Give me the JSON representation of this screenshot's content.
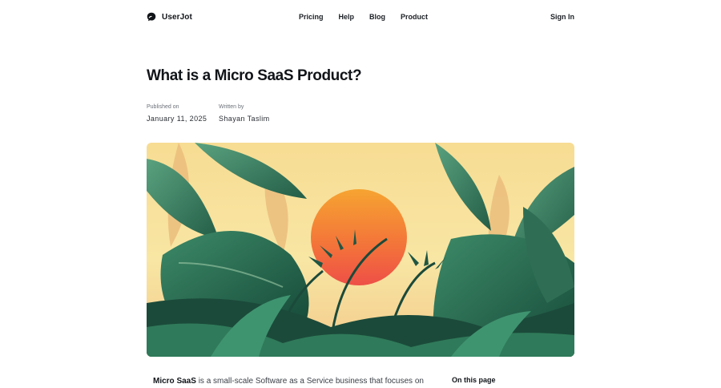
{
  "nav": {
    "brand": "UserJot",
    "links": [
      "Pricing",
      "Help",
      "Blog",
      "Product"
    ],
    "sign_in": "Sign In"
  },
  "article": {
    "title": "What is a Micro SaaS Product?",
    "published_label": "Published on",
    "published_date": "January 11, 2025",
    "author_label": "Written by",
    "author": "Shayan Taslim",
    "intro_bold": "Micro SaaS",
    "intro_rest": " is a small-scale Software as a Service business that focuses on"
  },
  "toc": {
    "title": "On this page"
  },
  "hero": {
    "subject": "tropical-sunset-illustration"
  }
}
